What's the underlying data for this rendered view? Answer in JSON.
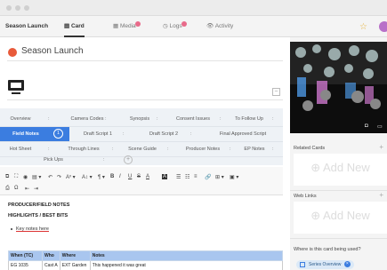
{
  "tabs": [
    {
      "label": "Season Launch",
      "active": false
    },
    {
      "label": "Card",
      "active": true,
      "icon": "card-icon"
    },
    {
      "label": "Media",
      "active": false,
      "icon": "media-icon",
      "badge": true
    },
    {
      "label": "Logs",
      "active": false,
      "icon": "clock-icon",
      "badge": true
    },
    {
      "label": "Activity",
      "active": false,
      "icon": "eye-icon"
    }
  ],
  "card": {
    "title": "Season Launch",
    "color": "#e85a3a"
  },
  "field_tabs": {
    "row1": [
      "Overview",
      "Camera Codes",
      "Synopsis",
      "Consent Issues",
      "To Follow Up"
    ],
    "row2": [
      "Field Notes",
      "Draft Script 1",
      "Draft Script 2",
      "Final Approved Script"
    ],
    "row2_count": "1",
    "row3": [
      "Hot Sheet",
      "Through Lines",
      "Scene Guide",
      "Producer Notes",
      "EP Notes"
    ],
    "row4": [
      "Pick Ups"
    ],
    "separator": ":",
    "plus": "+"
  },
  "toolbar": {
    "bold": "B",
    "italic": "I",
    "underline": "U",
    "strike": "S",
    "font_color": "A",
    "highlight": "A"
  },
  "document": {
    "heading1": "PRODUCER/FIELD NOTES",
    "heading2": "HIGHLIGHTS / BEST BITS",
    "bullet": "Key notes here",
    "table_headers": [
      "When (TC)",
      "Who",
      "Where",
      "Notes"
    ],
    "table_rows": [
      [
        "EG 1035",
        "Cast A",
        "EXT Garden",
        "This happened it was great"
      ]
    ]
  },
  "right_panel": {
    "related_cards": "Related Cards",
    "web_links": "Web Links",
    "add_new": "Add New",
    "where_used": "Where is this card being used?",
    "chip_label": "Series Overview",
    "plus": "+"
  },
  "colors": {
    "accent": "#3b7de0",
    "header_blue": "#a9c6ef"
  }
}
